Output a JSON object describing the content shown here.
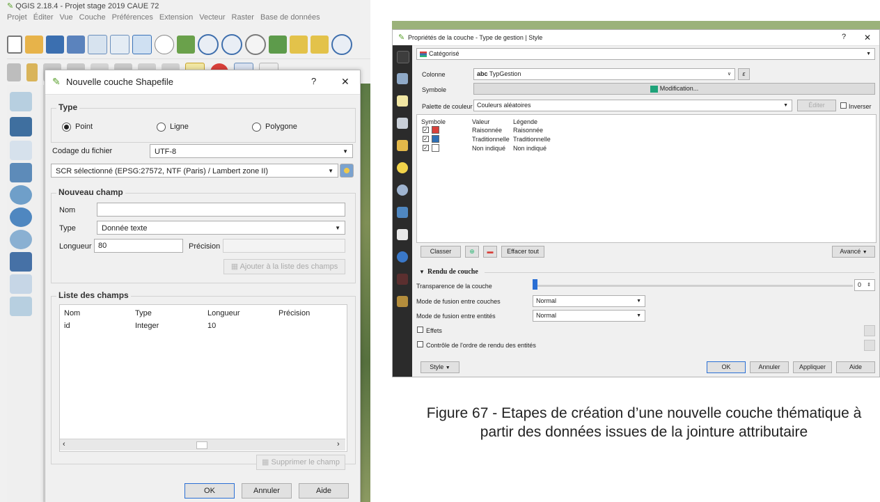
{
  "left_window": {
    "title": "QGIS 2.18.4 - Projet stage 2019 CAUE 72",
    "menu": [
      "Projet",
      "Éditer",
      "Vue",
      "Couche",
      "Préférences",
      "Extension",
      "Vecteur",
      "Raster",
      "Base de données"
    ]
  },
  "shapefile_dialog": {
    "title": "Nouvelle couche Shapefile",
    "help_btn": "?",
    "close_btn": "✕",
    "type_group": "Type",
    "type_options": [
      "Point",
      "Ligne",
      "Polygone"
    ],
    "selected_type": "Point",
    "encoding_label": "Codage du fichier",
    "encoding_value": "UTF-8",
    "crs_value": "SCR sélectionné (EPSG:27572, NTF (Paris) / Lambert zone II)",
    "new_field_group": "Nouveau champ",
    "name_label": "Nom",
    "name_value": "",
    "field_type_label": "Type",
    "field_type_value": "Donnée texte",
    "length_label": "Longueur",
    "length_value": "80",
    "precision_label": "Précision",
    "add_field_btn": "Ajouter à la liste des champs",
    "field_list_group": "Liste des champs",
    "field_columns": [
      "Nom",
      "Type",
      "Longueur",
      "Précision"
    ],
    "field_rows": [
      [
        "id",
        "Integer",
        "10",
        ""
      ]
    ],
    "delete_field_btn": "Supprimer le champ",
    "ok_btn": "OK",
    "cancel_btn": "Annuler",
    "help_btn_label": "Aide"
  },
  "props_dialog": {
    "title": "Propriétés de la couche - Type de gestion | Style",
    "help_btn": "?",
    "close_btn": "✕",
    "renderer": "Catégorisé",
    "column_label": "Colonne",
    "column_prefix": "abc",
    "column_value": "TypGestion",
    "symbol_label": "Symbole",
    "symbol_btn": "Modification...",
    "palette_label": "Palette de couleur",
    "palette_value": "Couleurs aléatoires",
    "edit_btn": "Éditer",
    "invert_label": "Inverser",
    "cat_headers": [
      "Symbole",
      "Valeur",
      "Légende"
    ],
    "categories": [
      {
        "value": "Raisonnée",
        "legend": "Raisonnée",
        "color": "#d9403a",
        "checked": true
      },
      {
        "value": "Traditionnelle",
        "legend": "Traditionnelle",
        "color": "#2d6fb5",
        "checked": true
      },
      {
        "value": "Non indiqué",
        "legend": "Non indiqué",
        "color": "#ffffff",
        "checked": true
      }
    ],
    "classify_btn": "Classer",
    "clear_btn": "Effacer tout",
    "advanced_btn": "Avancé",
    "render_group": "Rendu de couche",
    "transparency_label": "Transparence de la couche",
    "transparency_value": "0",
    "layer_blend_label": "Mode de fusion entre couches",
    "layer_blend_value": "Normal",
    "feature_blend_label": "Mode de fusion entre entités",
    "feature_blend_value": "Normal",
    "effects_label": "Effets",
    "order_label": "Contrôle de l'ordre de rendu des entités",
    "style_btn": "Style",
    "ok_btn": "OK",
    "cancel_btn": "Annuler",
    "apply_btn": "Appliquer",
    "help_btn_label": "Aide"
  },
  "caption": "Figure 67 - Etapes de création d’une nouvelle couche thématique à partir des données issues de la jointure attributaire",
  "colors": {
    "accent_green": "#2bb673",
    "swatch_green": "#1fa37a",
    "sidebar_dark": "#2b2b2b",
    "map_green": "#6e8a4c"
  }
}
